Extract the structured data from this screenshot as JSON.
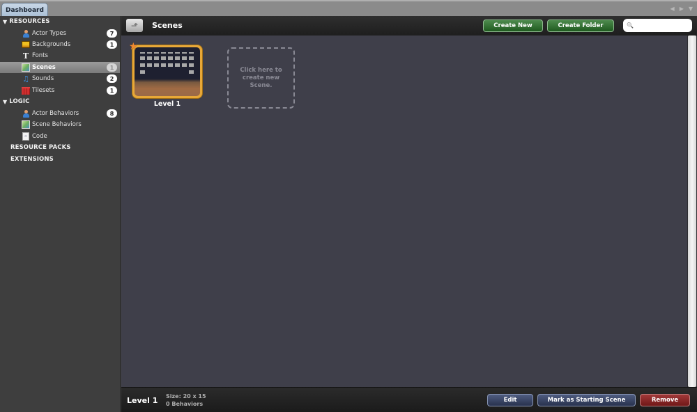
{
  "tabs": [
    {
      "label": "Dashboard",
      "active": true
    }
  ],
  "tab_controls": {
    "prev_icon": "◀",
    "next_icon": "▶",
    "menu_icon": "▼"
  },
  "sidebar": {
    "sections": [
      {
        "label": "RESOURCES",
        "expander": "▼",
        "items": [
          {
            "label": "Actor Types",
            "icon": "actor-icon",
            "count": "7"
          },
          {
            "label": "Backgrounds",
            "icon": "background-icon",
            "count": "1"
          },
          {
            "label": "Fonts",
            "icon": "font-icon",
            "glyph": "T",
            "count": null
          },
          {
            "label": "Scenes",
            "icon": "scene-icon",
            "count": "1",
            "selected": true
          },
          {
            "label": "Sounds",
            "icon": "sound-icon",
            "glyph": "♫",
            "count": "2"
          },
          {
            "label": "Tilesets",
            "icon": "tileset-icon",
            "count": "1"
          }
        ]
      },
      {
        "label": "LOGIC",
        "expander": "▼",
        "items": [
          {
            "label": "Actor Behaviors",
            "icon": "actor-icon",
            "count": "8"
          },
          {
            "label": "Scene Behaviors",
            "icon": "scene-icon",
            "count": null
          },
          {
            "label": "Code",
            "icon": "code-icon",
            "glyph": "‹›",
            "count": null
          }
        ]
      },
      {
        "label": "RESOURCE PACKS"
      },
      {
        "label": "EXTENSIONS"
      }
    ]
  },
  "header": {
    "up_icon": "⬏",
    "title": "Scenes",
    "create_new_label": "Create New",
    "create_folder_label": "Create Folder",
    "search_icon": "🔍",
    "search_placeholder": "",
    "search_value": ""
  },
  "scenes": [
    {
      "name": "Level 1",
      "starting": true,
      "star_glyph": "★"
    }
  ],
  "new_scene_prompt": "Click here to create new Scene.",
  "footer": {
    "selected_name": "Level 1",
    "size": "Size: 20 x 15",
    "behaviors": "0 Behaviors",
    "edit_label": "Edit",
    "mark_starting_label": "Mark as Starting Scene",
    "remove_label": "Remove"
  },
  "colors": {
    "accent_green": "#2f6f2f",
    "accent_blue": "#3a4664",
    "accent_red": "#8a2828",
    "scene_frame": "#e8a838"
  }
}
